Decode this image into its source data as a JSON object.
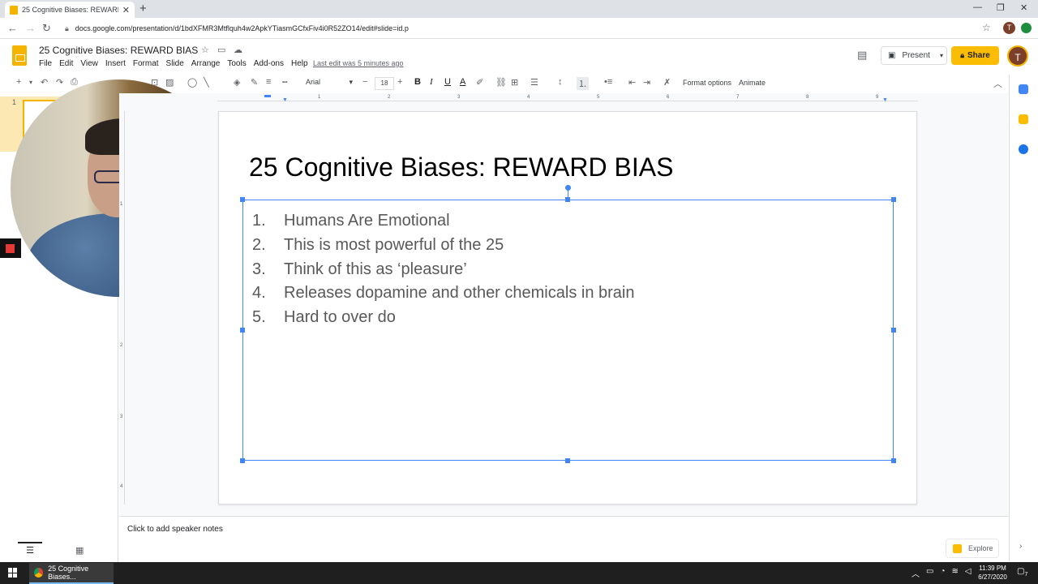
{
  "browser": {
    "tab_title": "25 Cognitive Biases: REWARD BIAS",
    "tab_close": "✕",
    "new_tab": "+",
    "url": "docs.google.com/presentation/d/1bdXFMR3Mtflquh4w2ApkYTiasmGCfxFiv4i0R52ZO14/edit#slide=id.p",
    "profile_initial": "T",
    "window_controls": [
      "—",
      "❐",
      "✕"
    ]
  },
  "app": {
    "doc_title": "25 Cognitive Biases: REWARD BIAS",
    "menu": [
      "File",
      "Edit",
      "View",
      "Insert",
      "Format",
      "Slide",
      "Arrange",
      "Tools",
      "Add-ons",
      "Help"
    ],
    "last_edit": "Last edit was 5 minutes ago",
    "present_label": "Present",
    "share_label": "Share",
    "avatar_initial": "T"
  },
  "toolbar": {
    "font": "Arial",
    "font_size": "18",
    "format_options": "Format options",
    "animate": "Animate"
  },
  "filmstrip": {
    "slide_number": "1"
  },
  "slide": {
    "title": "25 Cognitive Biases: REWARD BIAS",
    "items": [
      {
        "num": "1.",
        "text": "Humans Are Emotional"
      },
      {
        "num": "2.",
        "text": "This is most powerful of the 25"
      },
      {
        "num": "3.",
        "text": "Think of this as ‘pleasure’"
      },
      {
        "num": "4.",
        "text": "Releases dopamine and other chemicals in brain"
      },
      {
        "num": "5.",
        "text": "Hard to over do"
      }
    ]
  },
  "ruler": {
    "h_ticks": [
      "1",
      "2",
      "3",
      "4",
      "5",
      "6",
      "7",
      "8",
      "9"
    ],
    "v_ticks": [
      "1",
      "2",
      "3",
      "4"
    ]
  },
  "notes": {
    "placeholder": "Click to add speaker notes"
  },
  "explore": {
    "label": "Explore"
  },
  "taskbar": {
    "task_label": "25 Cognitive Biases...",
    "time": "11:39 PM",
    "date": "6/27/2020",
    "notif_count": "7"
  },
  "colors": {
    "accent_yellow": "#fbbc04",
    "selection_blue": "#4285f4",
    "body_text": "#595959"
  }
}
